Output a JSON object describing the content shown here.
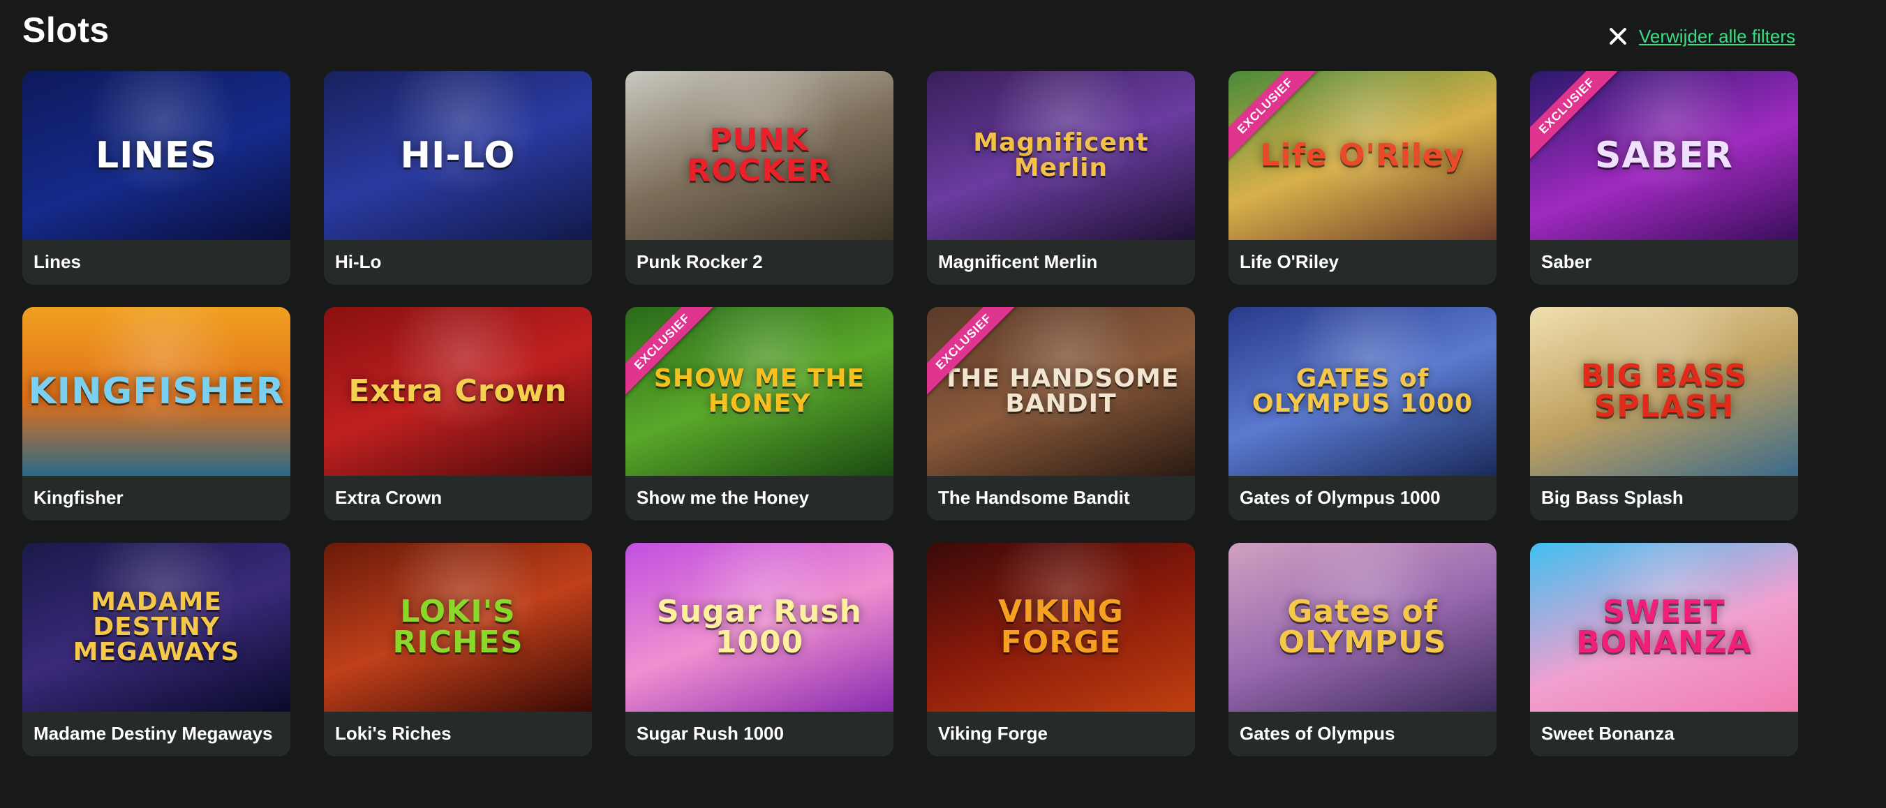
{
  "page": {
    "title": "Slots",
    "clear_filters_label": "Verwijder alle filters"
  },
  "games": [
    {
      "title": "Lines",
      "logo": "LINES",
      "bg": "linear-gradient(160deg,#0e1a5c,#152a8a 55%,#0a0f3a)",
      "logo_color": "#ffffff",
      "exclusive": false
    },
    {
      "title": "Hi-Lo",
      "logo": "HI-LO",
      "bg": "linear-gradient(160deg,#18225e,#2a3aa0 50%,#111a4a)",
      "logo_color": "#ffffff",
      "exclusive": false
    },
    {
      "title": "Punk Rocker 2",
      "logo": "PUNK ROCKER",
      "bg": "linear-gradient(160deg,#c9c9c0,#7d6e5a 50%,#3a3325)",
      "logo_color": "#e8212b",
      "exclusive": false
    },
    {
      "title": "Magnificent Merlin",
      "logo": "Magnificent Merlin",
      "bg": "linear-gradient(160deg,#3a1f5a,#6a3ca0 50%,#1f1233)",
      "logo_color": "#f3c04a",
      "exclusive": false
    },
    {
      "title": "Life O'Riley",
      "logo": "Life O'Riley",
      "bg": "linear-gradient(160deg,#4a8a3a,#d8b04a 50%,#6a3a2a)",
      "logo_color": "#e84a2a",
      "exclusive": true,
      "exclusive_label": "EXCLUSIEF"
    },
    {
      "title": "Saber",
      "logo": "SABER",
      "bg": "linear-gradient(160deg,#2a1a6a,#a02ac0 55%,#3a0f5a)",
      "logo_color": "#f0e0ff",
      "exclusive": true,
      "exclusive_label": "EXCLUSIEF"
    },
    {
      "title": "Kingfisher",
      "logo": "KINGFISHER",
      "bg": "linear-gradient(180deg,#f0a020,#e0701a 55%,#2a6a8a)",
      "logo_color": "#7ad0f0",
      "exclusive": false
    },
    {
      "title": "Extra Crown",
      "logo": "Extra Crown",
      "bg": "linear-gradient(160deg,#8a1010,#c02020 50%,#4a0a0a)",
      "logo_color": "#f5d050",
      "exclusive": false
    },
    {
      "title": "Show me the Honey",
      "logo": "SHOW ME THE HONEY",
      "bg": "linear-gradient(160deg,#2a6a1a,#5aa82a 50%,#1a4a12)",
      "logo_color": "#f5c020",
      "exclusive": true,
      "exclusive_label": "EXCLUSIEF"
    },
    {
      "title": "The Handsome Bandit",
      "logo": "THE HANDSOME BANDIT",
      "bg": "linear-gradient(160deg,#5a3a2a,#8a5a3a 50%,#2a1a12)",
      "logo_color": "#f2e6d0",
      "exclusive": true,
      "exclusive_label": "EXCLUSIEF"
    },
    {
      "title": "Gates of Olympus 1000",
      "logo": "GATES of OLYMPUS 1000",
      "bg": "linear-gradient(160deg,#2a3a8a,#5a7ad0 50%,#1a2a5a)",
      "logo_color": "#f5c84a",
      "exclusive": false
    },
    {
      "title": "Big Bass Splash",
      "logo": "BIG BASS SPLASH",
      "bg": "linear-gradient(160deg,#f0e0b0,#c0a060 50%,#3a6a8a)",
      "logo_color": "#e02a1a",
      "exclusive": false
    },
    {
      "title": "Madame Destiny Megaways",
      "logo": "MADAME DESTINY MEGAWAYS",
      "bg": "linear-gradient(160deg,#1a1a4a,#3a2a7a 50%,#0a0a2a)",
      "logo_color": "#f5c84a",
      "exclusive": false
    },
    {
      "title": "Loki's Riches",
      "logo": "LOKI'S RICHES",
      "bg": "linear-gradient(160deg,#6a1a0a,#c0401a 50%,#3a0a05)",
      "logo_color": "#8ad82a",
      "exclusive": false
    },
    {
      "title": "Sugar Rush 1000",
      "logo": "Sugar Rush 1000",
      "bg": "linear-gradient(160deg,#c050e0,#f090d0 50%,#8a2ab0)",
      "logo_color": "#fff0a0",
      "exclusive": false
    },
    {
      "title": "Viking Forge",
      "logo": "VIKING FORGE",
      "bg": "linear-gradient(160deg,#3a0a0a,#8a1a0a 50%,#c04010)",
      "logo_color": "#f5a020",
      "exclusive": false
    },
    {
      "title": "Gates of Olympus",
      "logo": "Gates of OLYMPUS",
      "bg": "linear-gradient(160deg,#d0a0c0,#9a6ab0 50%,#3a2a5a)",
      "logo_color": "#f5c84a",
      "exclusive": false
    },
    {
      "title": "Sweet Bonanza",
      "logo": "SWEET BONANZA",
      "bg": "linear-gradient(160deg,#40c0f0,#f0a0d0 55%,#f07ab0)",
      "logo_color": "#f0207a",
      "exclusive": false
    }
  ]
}
